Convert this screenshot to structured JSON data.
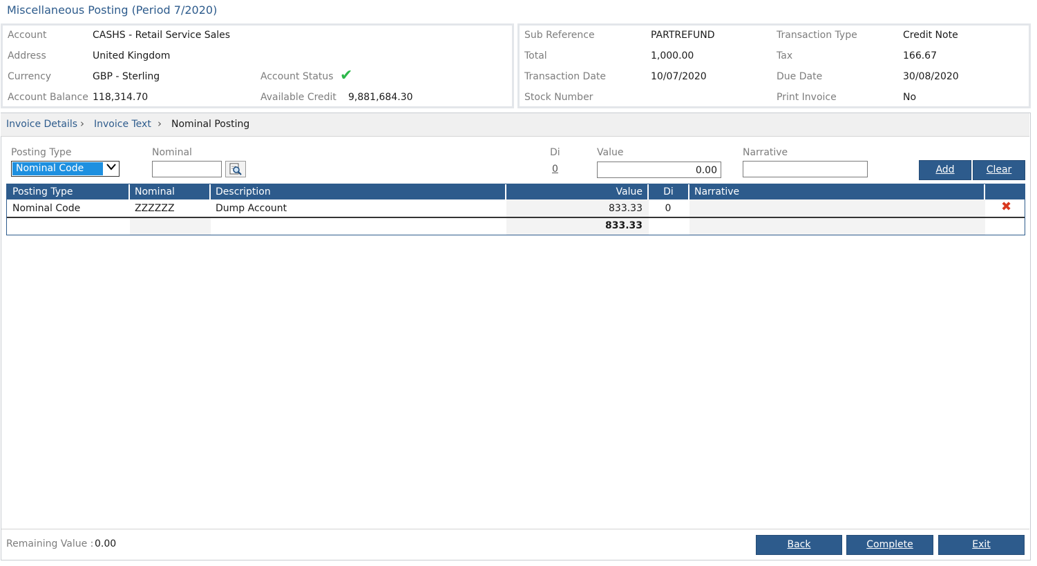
{
  "title": "Miscellaneous Posting (Period 7/2020)",
  "account_panel": {
    "account_label": "Account",
    "account_value": "CASHS - Retail Service Sales",
    "address_label": "Address",
    "address_value": "United Kingdom",
    "currency_label": "Currency",
    "currency_value": "GBP - Sterling",
    "account_status_label": "Account Status",
    "account_status_icon": "check-icon",
    "balance_label": "Account Balance",
    "balance_value": "118,314.70",
    "available_credit_label": "Available Credit",
    "available_credit_value": "9,881,684.30"
  },
  "transaction_panel": {
    "sub_ref_label": "Sub Reference",
    "sub_ref_value": "PARTREFUND",
    "txn_type_label": "Transaction Type",
    "txn_type_value": "Credit Note",
    "total_label": "Total",
    "total_value": "1,000.00",
    "tax_label": "Tax",
    "tax_value": "166.67",
    "txn_date_label": "Transaction Date",
    "txn_date_value": "10/07/2020",
    "due_date_label": "Due Date",
    "due_date_value": "30/08/2020",
    "stock_label": "Stock Number",
    "stock_value": "",
    "print_label": "Print Invoice",
    "print_value": "No"
  },
  "breadcrumb": {
    "items": [
      "Invoice Details",
      "Invoice Text"
    ],
    "current": "Nominal Posting"
  },
  "form": {
    "posting_type_label": "Posting Type",
    "posting_type_value": "Nominal Code",
    "nominal_label": "Nominal",
    "nominal_value": "",
    "di_label": "Di",
    "di_value": "0",
    "value_label": "Value",
    "value_value": "0.00",
    "narrative_label": "Narrative",
    "narrative_value": "",
    "add_label": "Add",
    "clear_label": "Clear"
  },
  "grid": {
    "columns": [
      "Posting Type",
      "Nominal",
      "Description",
      "Value",
      "Di",
      "Narrative"
    ],
    "rows": [
      {
        "posting_type": "Nominal Code",
        "nominal": "ZZZZZZ",
        "description": "Dump Account",
        "value": "833.33",
        "di": "0",
        "narrative": ""
      }
    ],
    "total_value": "833.33"
  },
  "footer": {
    "remaining_label": "Remaining Value :",
    "remaining_value": "0.00",
    "back_label": "Back",
    "complete_label": "Complete",
    "exit_label": "Exit"
  },
  "colors": {
    "accent": "#2d5b8c",
    "selection": "#1e90e0",
    "check": "#2db84a",
    "delete": "#d9381e"
  }
}
